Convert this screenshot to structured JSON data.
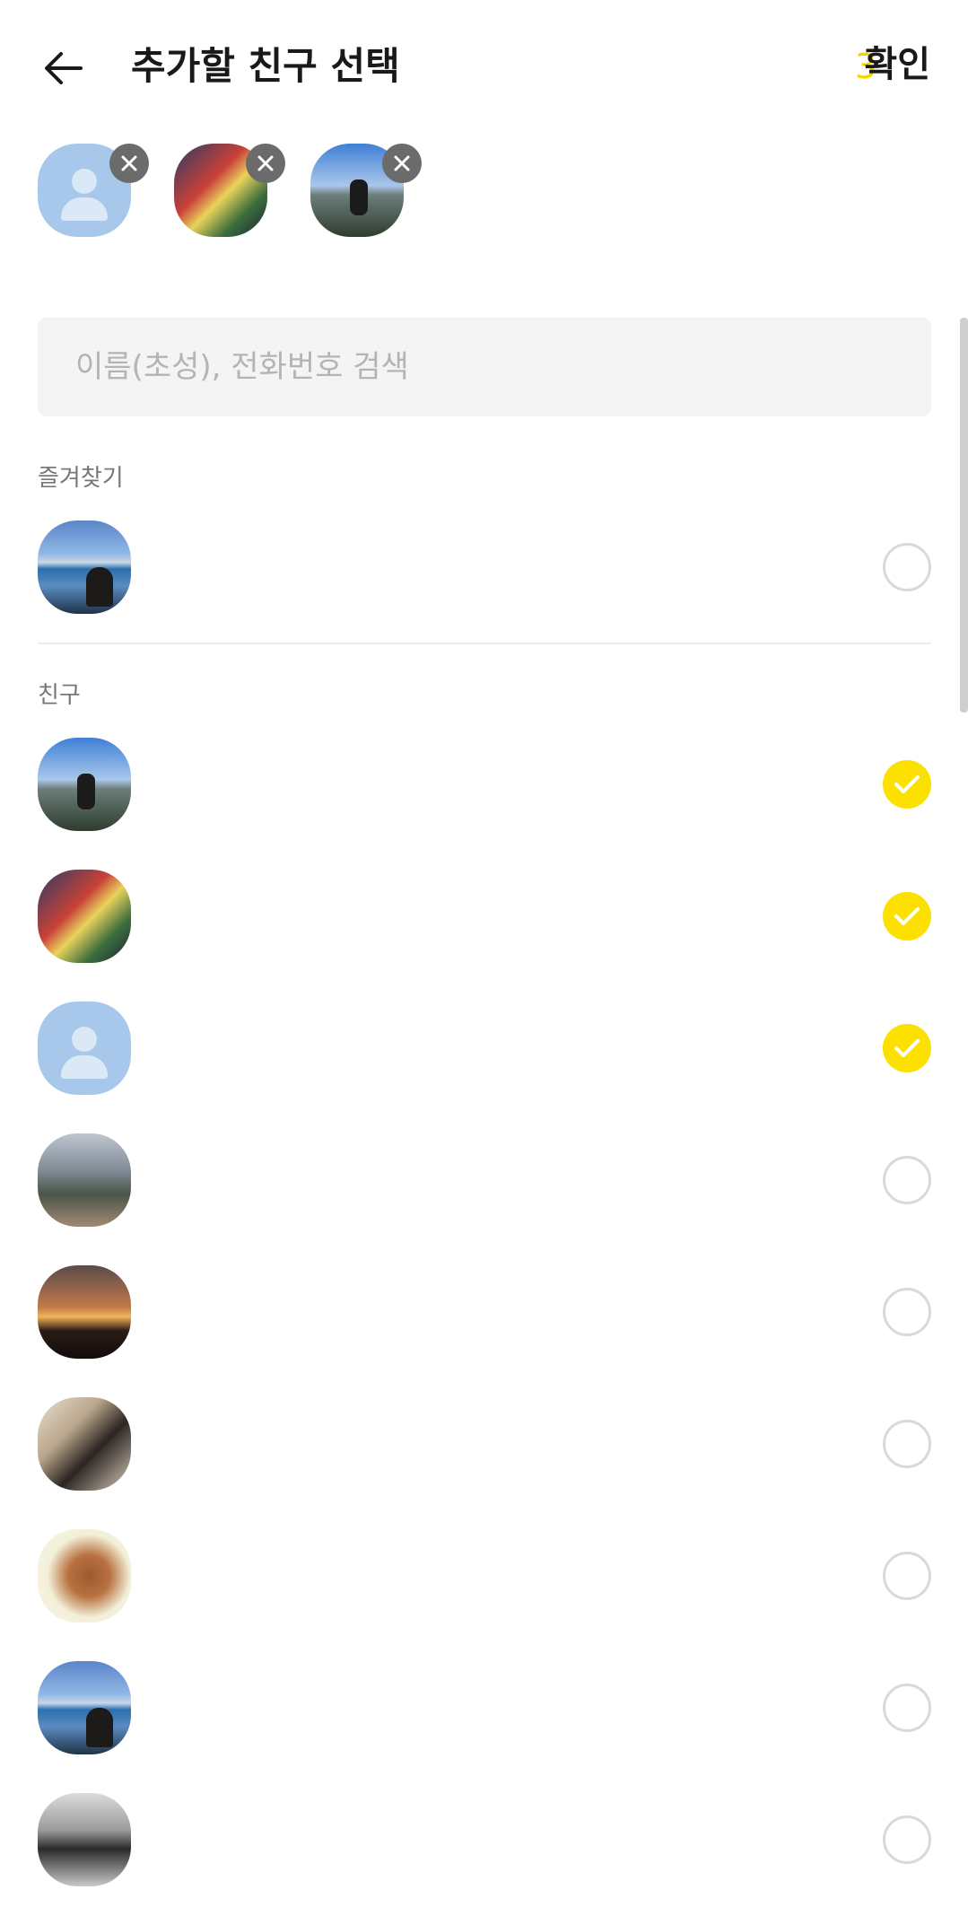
{
  "header": {
    "title": "추가할 친구 선택",
    "selected_count": "3",
    "confirm_label": "확인"
  },
  "selected": [
    {
      "avatar": "default-person",
      "remove_icon": "close-icon"
    },
    {
      "avatar": "graffiti-photo",
      "remove_icon": "close-icon"
    },
    {
      "avatar": "cliff-photo",
      "remove_icon": "close-icon"
    }
  ],
  "search": {
    "placeholder": "이름(초성), 전화번호 검색",
    "value": ""
  },
  "sections": {
    "favorites_label": "즐겨찾기",
    "friends_label": "친구"
  },
  "favorites": [
    {
      "avatar": "mountain-lake-photo",
      "checked": false
    }
  ],
  "friends": [
    {
      "avatar": "cliff-photo",
      "checked": true
    },
    {
      "avatar": "graffiti-photo",
      "checked": true
    },
    {
      "avatar": "default-person",
      "checked": true
    },
    {
      "avatar": "street-photo",
      "checked": false
    },
    {
      "avatar": "sunset-photo",
      "checked": false
    },
    {
      "avatar": "couple-photo",
      "checked": false
    },
    {
      "avatar": "dog-photo",
      "checked": false
    },
    {
      "avatar": "mountain-lake-photo",
      "checked": false
    },
    {
      "avatar": "suits-photo",
      "checked": false
    }
  ],
  "colors": {
    "accent_yellow": "#fbe000",
    "count_yellow": "#f5d300",
    "default_avatar": "#a7c8ea"
  }
}
